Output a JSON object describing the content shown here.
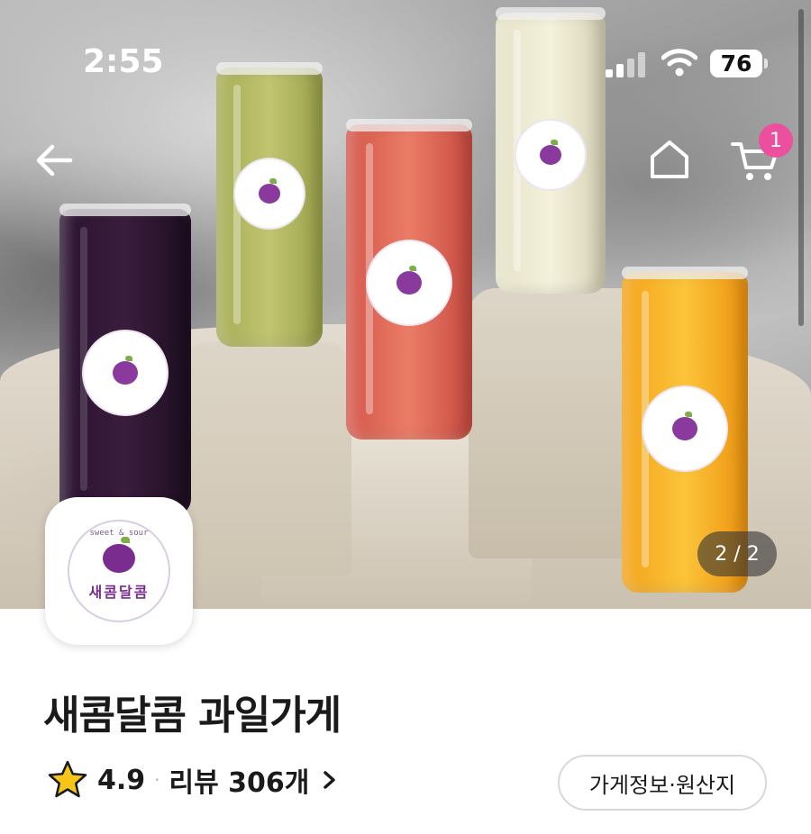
{
  "status_bar": {
    "time": "2:55",
    "battery": "76"
  },
  "nav": {
    "back_icon": "arrow-left-icon",
    "home_icon": "home-icon",
    "cart_icon": "cart-icon",
    "cart_count": "1"
  },
  "hero": {
    "page_counter": "2 / 2"
  },
  "logo": {
    "tagline": "sweet & sour",
    "name": "새콤달콤"
  },
  "store": {
    "title": "새콤달콤 과일가게",
    "rating": "4.9",
    "separator": "·",
    "reviews": "리뷰 306개",
    "info_button": "가게정보·원산지"
  },
  "colors": {
    "badge": "#ec4f9e",
    "plum": "#7a2d8e",
    "star": "#f5c518"
  }
}
